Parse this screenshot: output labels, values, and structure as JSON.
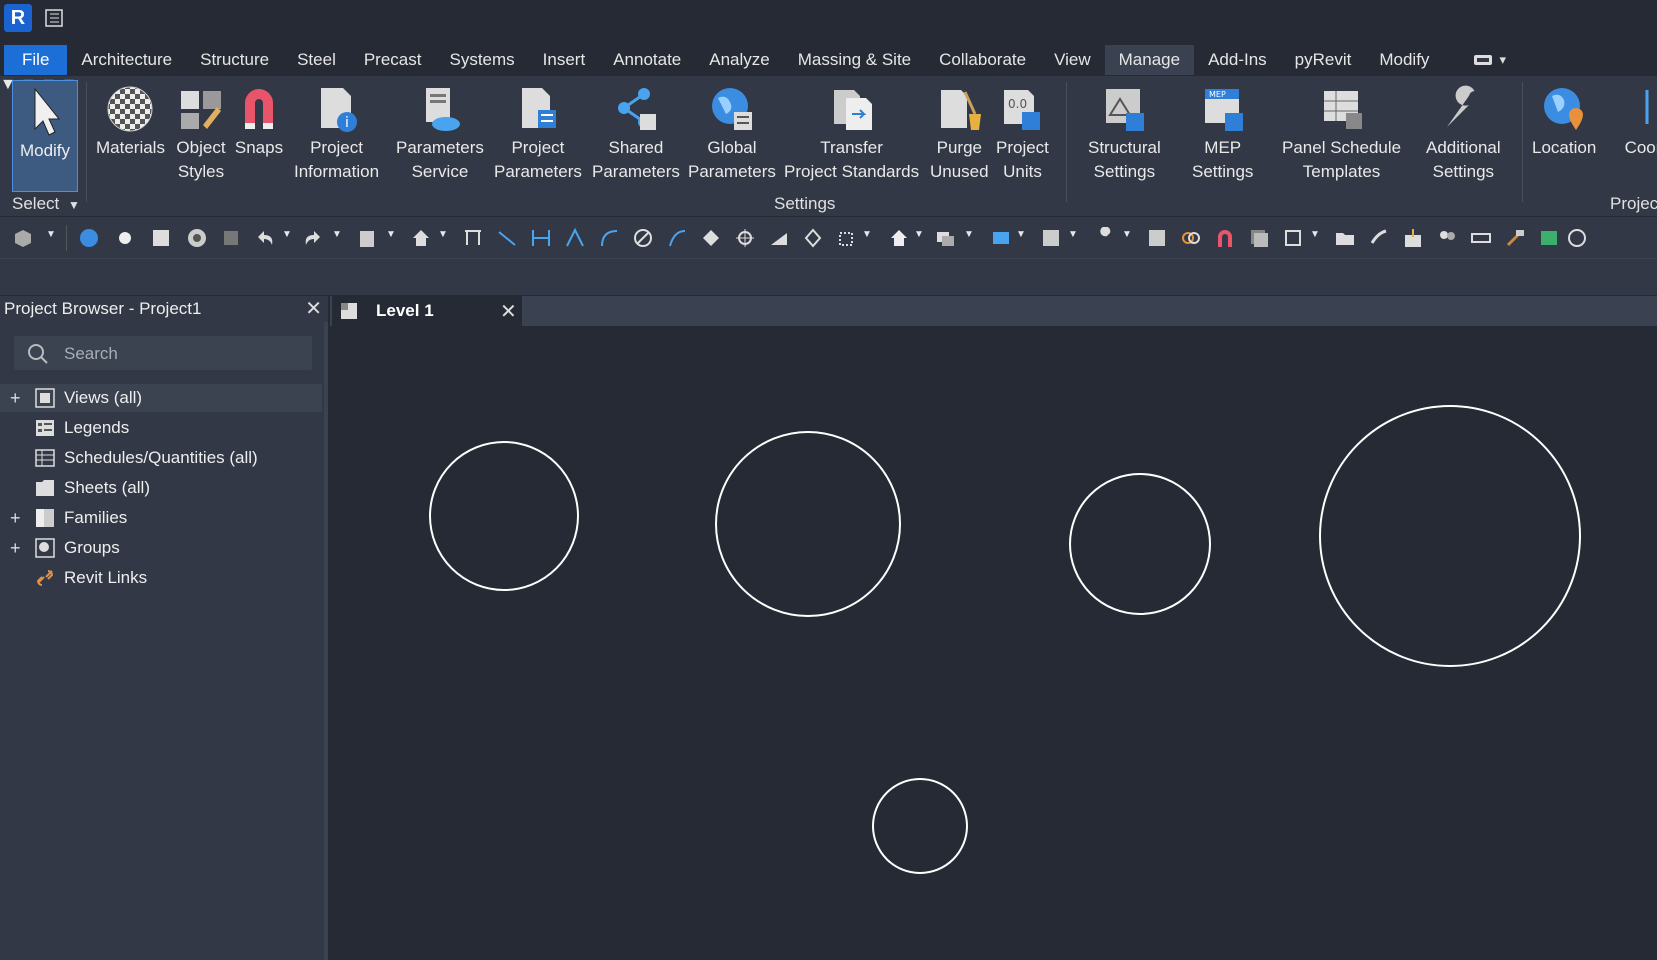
{
  "app": {
    "logo_letter": "R"
  },
  "menu": {
    "tabs": [
      "File",
      "Architecture",
      "Structure",
      "Steel",
      "Precast",
      "Systems",
      "Insert",
      "Annotate",
      "Analyze",
      "Massing & Site",
      "Collaborate",
      "View",
      "Manage",
      "Add-Ins",
      "pyRevit",
      "Modify"
    ],
    "active_tab": "Manage"
  },
  "ribbon": {
    "modify_label": "Modify",
    "select_label": "Select",
    "buttons": {
      "materials": "Materials",
      "object_styles": [
        "Object",
        "Styles"
      ],
      "snaps": "Snaps",
      "project_information": [
        "Project",
        "Information"
      ],
      "parameters_service": [
        "Parameters",
        "Service"
      ],
      "project_parameters": [
        "Project",
        "Parameters"
      ],
      "shared_parameters": [
        "Shared",
        "Parameters"
      ],
      "global_parameters": [
        "Global",
        "Parameters"
      ],
      "transfer_project_standards": [
        "Transfer",
        "Project Standards"
      ],
      "purge_unused": [
        "Purge",
        "Unused"
      ],
      "project_units": [
        "Project",
        "Units"
      ],
      "structural_settings": [
        "Structural",
        "Settings"
      ],
      "mep_settings": [
        "MEP",
        "Settings"
      ],
      "panel_schedule_templates": [
        "Panel Schedule",
        "Templates"
      ],
      "additional_settings": [
        "Additional",
        "Settings"
      ],
      "location": "Location",
      "coordinates": "Coor"
    },
    "panels": {
      "settings": "Settings",
      "project_location": "Projec"
    }
  },
  "project_browser": {
    "title": "Project Browser - Project1",
    "search_placeholder": "Search",
    "items": [
      {
        "label": "Views (all)",
        "expandable": true,
        "icon": "views-icon",
        "selected": true
      },
      {
        "label": "Legends",
        "expandable": false,
        "icon": "legends-icon"
      },
      {
        "label": "Schedules/Quantities (all)",
        "expandable": false,
        "icon": "schedules-icon"
      },
      {
        "label": "Sheets (all)",
        "expandable": false,
        "icon": "sheets-icon"
      },
      {
        "label": "Families",
        "expandable": true,
        "icon": "families-icon"
      },
      {
        "label": "Groups",
        "expandable": true,
        "icon": "groups-icon"
      },
      {
        "label": "Revit Links",
        "expandable": false,
        "icon": "revit-links-icon"
      }
    ]
  },
  "view": {
    "tab_label": "Level 1",
    "circles_count": 5
  },
  "colors": {
    "background": "#252a34",
    "ribbon": "#323845",
    "accent": "#1c6fd6",
    "drawing_line": "#ffffff"
  }
}
